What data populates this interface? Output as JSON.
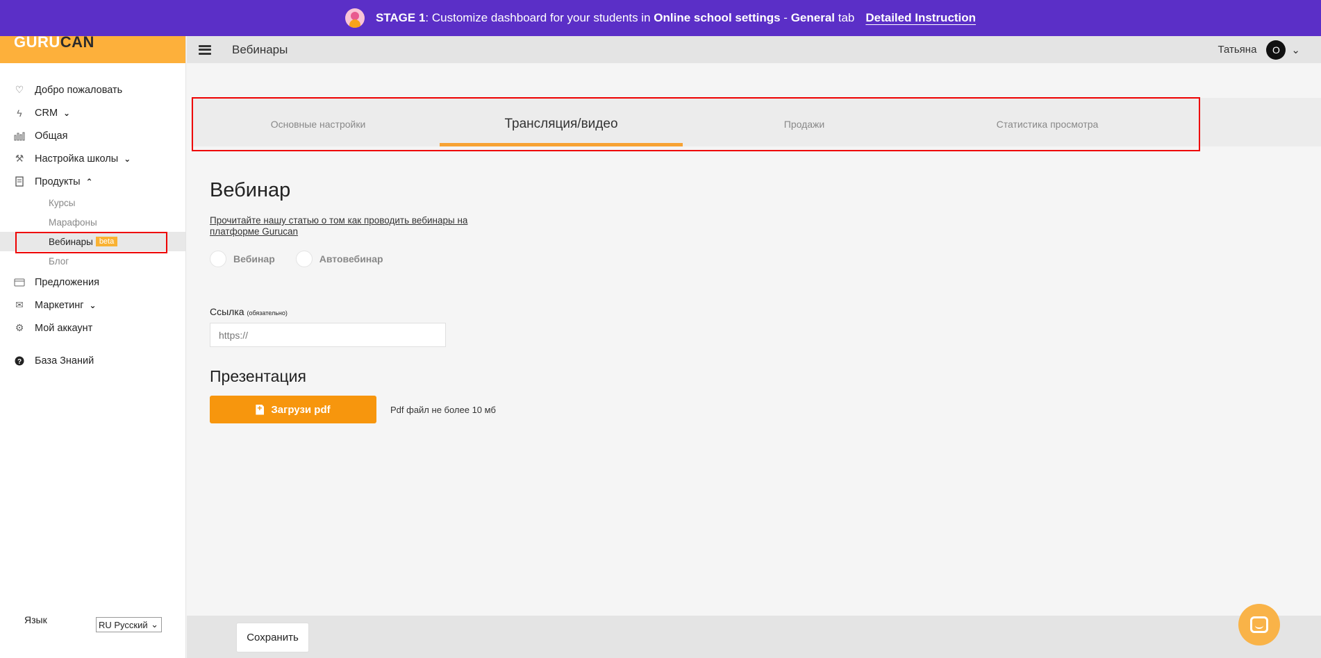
{
  "banner": {
    "stage": "STAGE 1",
    "text_a": ": Customize dashboard for your students in ",
    "bold_b": "Online school settings",
    "text_c": " - ",
    "bold_d": "General",
    "text_e": " tab",
    "link": "Detailed Instruction",
    "bg_color": "#5b2fc7"
  },
  "logo": {
    "guru": "GURU",
    "can": "CAN"
  },
  "sidebar": {
    "items": [
      {
        "label": "Добро пожаловать",
        "icon": "heart-icon"
      },
      {
        "label": "CRM",
        "icon": "lightning-icon",
        "chevron": "down"
      },
      {
        "label": "Общая",
        "icon": "bar-chart-icon"
      },
      {
        "label": "Настройка школы",
        "icon": "hammer-icon",
        "chevron": "down"
      },
      {
        "label": "Продукты",
        "icon": "document-icon",
        "chevron": "up"
      }
    ],
    "sub_items": [
      {
        "label": "Курсы"
      },
      {
        "label": "Марафоны"
      },
      {
        "label": "Вебинары",
        "badge": "beta",
        "active": true
      },
      {
        "label": "Блог"
      }
    ],
    "items_after": [
      {
        "label": "Предложения",
        "icon": "card-icon"
      },
      {
        "label": "Маркетинг",
        "icon": "envelope-icon",
        "chevron": "down"
      },
      {
        "label": "Мой аккаунт",
        "icon": "gear-icon"
      }
    ],
    "knowledge_base": {
      "label": "База Знаний",
      "icon": "question-icon"
    },
    "language_label": "Язык",
    "language_value": "RU Русский"
  },
  "header": {
    "title": "Вебинары",
    "user_name": "Татьяна",
    "avatar_letter": "О"
  },
  "tabs": [
    {
      "label": "Основные настройки",
      "active": false
    },
    {
      "label": "Трансляция/видео",
      "active": true
    },
    {
      "label": "Продажи",
      "active": false
    },
    {
      "label": "Статистика просмотра",
      "active": false
    }
  ],
  "main": {
    "heading": "Вебинар",
    "article_link": "Прочитайте нашу статью о том как проводить вебинары на платформе Gurucan",
    "radio_webinar": "Вебинар",
    "radio_autowebinar": "Автовебинар",
    "link_label": "Ссылка",
    "link_required": "(обязательно)",
    "link_placeholder": "https://",
    "presentation_heading": "Презентация",
    "upload_button": "Загрузи pdf",
    "pdf_note": "Pdf файл не более 10 мб",
    "accent_color": "#f7960d"
  },
  "footer": {
    "save_button": "Сохранить"
  }
}
